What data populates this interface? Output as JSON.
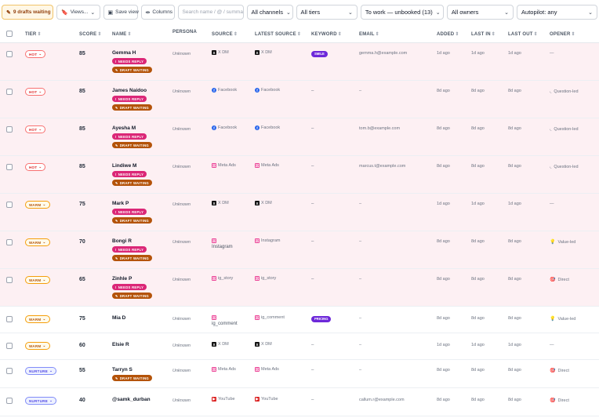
{
  "toolbar": {
    "drafts_label": "9 drafts waiting",
    "views_label": "Views...",
    "save_view_label": "Save view",
    "columns_label": "Columns",
    "search_placeholder": "Search name / @ / summa",
    "channels_value": "All channels",
    "tiers_value": "All tiers",
    "stage_value": "To work — unbooked (13)",
    "owners_value": "All owners",
    "autopilot_value": "Autopilot: any"
  },
  "columns": {
    "tier": "TIER",
    "score": "SCORE",
    "name": "NAME",
    "persona": "PERSONA",
    "source": "SOURCE",
    "latest_source": "LATEST SOURCE",
    "keyword": "KEYWORD",
    "email": "EMAIL",
    "added": "ADDED",
    "last_in": "LAST IN",
    "last_out": "LAST OUT",
    "opener": "OPENER"
  },
  "pills": {
    "needs_reply": "NEEDS REPLY",
    "draft_waiting": "DRAFT WAITING"
  },
  "rows": [
    {
      "tier": "HOT",
      "score": "85",
      "name": "Gemma H",
      "persona": "Unknown",
      "source": "X DM",
      "source_icon": "x-icon",
      "latest": "X DM",
      "latest_icon": "x-icon",
      "keyword": "SMILE",
      "email": "gemma.h@example.com",
      "added": "1d ago",
      "last_in": "1d ago",
      "last_out": "1d ago",
      "opener": "—",
      "opener_icon": "",
      "needs_reply": true,
      "draft": true
    },
    {
      "tier": "HOT",
      "score": "85",
      "name": "James Naidoo",
      "persona": "Unknown",
      "source": "Facebook",
      "source_icon": "facebook-icon",
      "latest": "Facebook",
      "latest_icon": "facebook-icon",
      "keyword": "–",
      "email": "–",
      "added": "8d ago",
      "last_in": "8d ago",
      "last_out": "8d ago",
      "opener": "Question-led",
      "opener_icon": "question-icon",
      "needs_reply": true,
      "draft": true
    },
    {
      "tier": "HOT",
      "score": "85",
      "name": "Ayesha M",
      "persona": "Unknown",
      "source": "Facebook",
      "source_icon": "facebook-icon",
      "latest": "Facebook",
      "latest_icon": "facebook-icon",
      "keyword": "–",
      "email": "tom.b@example.com",
      "added": "8d ago",
      "last_in": "8d ago",
      "last_out": "8d ago",
      "opener": "Question-led",
      "opener_icon": "question-icon",
      "needs_reply": true,
      "draft": true
    },
    {
      "tier": "HOT",
      "score": "85",
      "name": "Lindiwe M",
      "persona": "Unknown",
      "source": "Meta Ads",
      "source_icon": "instagram-icon",
      "latest": "Meta Ads",
      "latest_icon": "instagram-icon",
      "keyword": "–",
      "email": "marcus.t@example.com",
      "added": "8d ago",
      "last_in": "8d ago",
      "last_out": "8d ago",
      "opener": "Question-led",
      "opener_icon": "question-icon",
      "needs_reply": true,
      "draft": true
    },
    {
      "tier": "WARM",
      "score": "75",
      "name": "Mark P",
      "persona": "Unknown",
      "source": "X DM",
      "source_icon": "x-icon",
      "latest": "X DM",
      "latest_icon": "x-icon",
      "keyword": "–",
      "email": "–",
      "added": "1d ago",
      "last_in": "1d ago",
      "last_out": "1d ago",
      "opener": "—",
      "opener_icon": "",
      "needs_reply": true,
      "draft": true
    },
    {
      "tier": "WARM",
      "score": "70",
      "name": "Bongi R",
      "persona": "Unknown",
      "source": "Instagram",
      "source_icon": "instagram-icon",
      "latest": "Instagram",
      "latest_icon": "instagram-icon",
      "keyword": "–",
      "email": "–",
      "added": "8d ago",
      "last_in": "8d ago",
      "last_out": "8d ago",
      "opener": "Value-led",
      "opener_icon": "bulb-icon",
      "needs_reply": true,
      "draft": true
    },
    {
      "tier": "WARM",
      "score": "65",
      "name": "Zinhle P",
      "persona": "Unknown",
      "source": "ig_story",
      "source_icon": "instagram-icon",
      "latest": "ig_story",
      "latest_icon": "instagram-icon",
      "keyword": "–",
      "email": "–",
      "added": "8d ago",
      "last_in": "8d ago",
      "last_out": "8d ago",
      "opener": "Direct",
      "opener_icon": "target-icon",
      "needs_reply": true,
      "draft": true
    },
    {
      "tier": "WARM",
      "score": "75",
      "name": "Mia D",
      "persona": "Unknown",
      "source": "ig_comment",
      "source_icon": "instagram-icon",
      "latest": "ig_comment",
      "latest_icon": "instagram-icon",
      "keyword": "PRICING",
      "email": "–",
      "added": "8d ago",
      "last_in": "8d ago",
      "last_out": "8d ago",
      "opener": "Value-led",
      "opener_icon": "bulb-icon",
      "needs_reply": false,
      "draft": false
    },
    {
      "tier": "WARM",
      "score": "60",
      "name": "Elsie R",
      "persona": "Unknown",
      "source": "X DM",
      "source_icon": "x-icon",
      "latest": "X DM",
      "latest_icon": "x-icon",
      "keyword": "–",
      "email": "–",
      "added": "1d ago",
      "last_in": "1d ago",
      "last_out": "1d ago",
      "opener": "—",
      "opener_icon": "",
      "needs_reply": false,
      "draft": false
    },
    {
      "tier": "NURTURE",
      "score": "55",
      "name": "Tarryn S",
      "persona": "Unknown",
      "source": "Meta Ads",
      "source_icon": "instagram-icon",
      "latest": "Meta Ads",
      "latest_icon": "instagram-icon",
      "keyword": "–",
      "email": "–",
      "added": "8d ago",
      "last_in": "8d ago",
      "last_out": "8d ago",
      "opener": "Direct",
      "opener_icon": "target-icon",
      "needs_reply": false,
      "draft": true
    },
    {
      "tier": "NURTURE",
      "score": "40",
      "name": "@samk_durban",
      "persona": "Unknown",
      "source": "YouTube",
      "source_icon": "youtube-icon",
      "latest": "YouTube",
      "latest_icon": "youtube-icon",
      "keyword": "–",
      "email": "callum.r@example.com",
      "added": "8d ago",
      "last_in": "8d ago",
      "last_out": "8d ago",
      "opener": "Direct",
      "opener_icon": "target-icon",
      "needs_reply": false,
      "draft": false
    }
  ],
  "colors": {
    "hot_row_bg": "#fdf0f3",
    "needs_reply": "#db2777",
    "draft_waiting": "#b45309",
    "keyword": "#6d28d9"
  }
}
